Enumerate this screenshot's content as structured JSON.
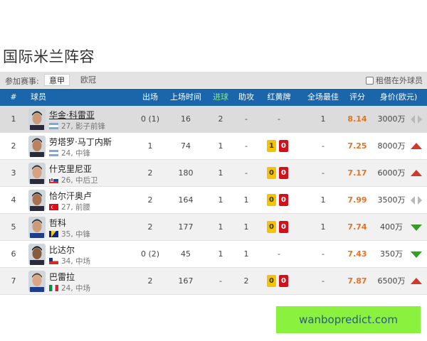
{
  "page": {
    "title": "国际米兰阵容"
  },
  "filter": {
    "label": "参加赛事:",
    "tabs": [
      {
        "label": "意甲",
        "active": true
      },
      {
        "label": "欧冠",
        "active": false
      }
    ],
    "loan_label": "租借在外球员",
    "loan_checked": false
  },
  "table": {
    "headers": {
      "num": "#",
      "player": "球员",
      "apps": "出场",
      "minutes": "上场时间",
      "goals": "进球",
      "assists": "助攻",
      "cards": "红黄牌",
      "motm": "全场最佳",
      "rating": "评分",
      "value": "身价(欧元)"
    },
    "rows": [
      {
        "num": "1",
        "name": "华金·科雷亚",
        "meta": "27, 影子前锋",
        "flag": "argentina",
        "apps": "0 (1)",
        "minutes": "16",
        "goals": "2",
        "assists": "-",
        "cards_text": "-",
        "yellow": null,
        "red": null,
        "motm": "1",
        "rating": "8.14",
        "value": "3000万",
        "trend": "flat"
      },
      {
        "num": "2",
        "name": "劳塔罗·马丁内斯",
        "meta": "24, 中锋",
        "flag": "argentina",
        "apps": "1",
        "minutes": "74",
        "goals": "1",
        "assists": "-",
        "cards_text": "",
        "yellow": "1",
        "red": "0",
        "motm": "-",
        "rating": "7.25",
        "value": "8000万",
        "trend": "up"
      },
      {
        "num": "3",
        "name": "什克里尼亚",
        "meta": "26, 中后卫",
        "flag": "slovakia",
        "apps": "2",
        "minutes": "180",
        "goals": "1",
        "assists": "-",
        "cards_text": "",
        "yellow": "0",
        "red": "0",
        "motm": "-",
        "rating": "7.17",
        "value": "6000万",
        "trend": "up"
      },
      {
        "num": "4",
        "name": "恰尔汗奥卢",
        "meta": "27, 前腰",
        "flag": "turkey",
        "apps": "2",
        "minutes": "164",
        "goals": "1",
        "assists": "1",
        "cards_text": "",
        "yellow": "0",
        "red": "0",
        "motm": "1",
        "rating": "7.99",
        "value": "3500万",
        "trend": "flat"
      },
      {
        "num": "5",
        "name": "哲科",
        "meta": "35, 中锋",
        "flag": "bosnia",
        "apps": "2",
        "minutes": "177",
        "goals": "1",
        "assists": "1",
        "cards_text": "",
        "yellow": "0",
        "red": "0",
        "motm": "1",
        "rating": "7.74",
        "value": "400万",
        "trend": "down"
      },
      {
        "num": "6",
        "name": "比达尔",
        "meta": "34, 中场",
        "flag": "chile",
        "apps": "0 (2)",
        "minutes": "45",
        "goals": "1",
        "assists": "1",
        "cards_text": "-",
        "yellow": null,
        "red": null,
        "motm": "-",
        "rating": "7.43",
        "value": "350万",
        "trend": "down"
      },
      {
        "num": "7",
        "name": "巴雷拉",
        "meta": "24, 中场",
        "flag": "italy",
        "apps": "2",
        "minutes": "167",
        "goals": "-",
        "assists": "2",
        "cards_text": "",
        "yellow": "0",
        "red": "0",
        "motm": "-",
        "rating": "7.87",
        "value": "6500万",
        "trend": "up"
      }
    ]
  },
  "watermark": "wanbopredict.com",
  "colors": {
    "header_bg": "#1b65aa",
    "goals_header": "#7ef06a",
    "rating": "#e27424",
    "trend_up": "#d03a2a",
    "trend_down": "#3b9a2a",
    "trend_flat": "#b8b8b8",
    "watermark_bg": "#8bf13f"
  }
}
